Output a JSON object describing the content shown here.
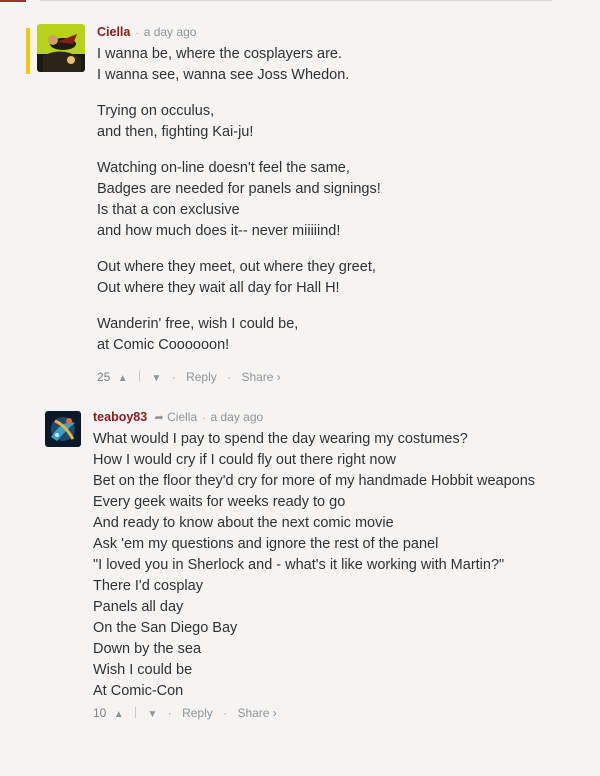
{
  "colors": {
    "accent": "#b0292a",
    "author": "#8a1c1c",
    "highlight": "#f5c500",
    "muted": "#8f9497"
  },
  "comments": [
    {
      "author": "Ciella",
      "time": "a day ago",
      "paragraphs": [
        [
          "I wanna be, where the cosplayers are.",
          "I wanna see, wanna see Joss Whedon."
        ],
        [
          "Trying on occulus,",
          "and then, fighting Kai-ju!"
        ],
        [
          "Watching on-line doesn't feel the same,",
          "Badges are needed for panels and signings!",
          "Is that a con exclusive",
          "and how much does it-- never miiiiind!"
        ],
        [
          "Out where they meet, out where they greet,",
          "Out where they wait all day for Hall H!"
        ],
        [
          "Wanderin' free, wish I could be,",
          "at Comic Coooooon!"
        ]
      ],
      "score": "25",
      "upvote_icon": "chevron-up-icon",
      "downvote_icon": "chevron-down-icon",
      "reply_label": "Reply",
      "share_label": "Share ›"
    },
    {
      "author": "teaboy83",
      "reply_to": "Ciella",
      "reply_to_icon": "reply-arrow-icon",
      "time": "a day ago",
      "lines": [
        "What would I pay to spend the day wearing my costumes?",
        "How I would cry if I could fly out there right now",
        "Bet on the floor they'd cry for more of my handmade Hobbit weapons",
        "Every geek waits for weeks ready to go",
        "And ready to know about the next comic movie",
        "Ask 'em my questions and ignore the rest of the panel",
        "\"I loved you in Sherlock and - what's it like working with Martin?\"",
        "There I'd cosplay",
        "Panels all day",
        "On the San Diego Bay",
        "Down by the sea",
        "Wish I could be",
        "At Comic-Con"
      ],
      "score": "10",
      "upvote_icon": "chevron-up-icon",
      "downvote_icon": "chevron-down-icon",
      "reply_label": "Reply",
      "share_label": "Share ›"
    }
  ]
}
